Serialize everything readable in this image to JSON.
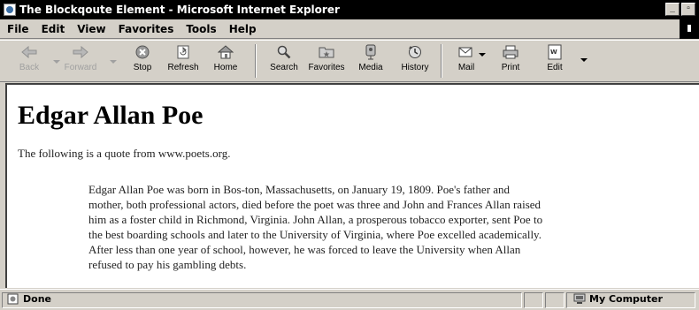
{
  "window": {
    "title": "The Blockqoute Element - Microsoft Internet Explorer"
  },
  "menu": [
    "File",
    "Edit",
    "View",
    "Favorites",
    "Tools",
    "Help"
  ],
  "toolbar": {
    "buttons": [
      {
        "label": "Back",
        "icon": "back-arrow-icon",
        "enabled": false
      },
      {
        "label": "Forward",
        "icon": "forward-arrow-icon",
        "enabled": false
      },
      {
        "label": "Stop",
        "icon": "stop-icon",
        "enabled": true
      },
      {
        "label": "Refresh",
        "icon": "refresh-icon",
        "enabled": true
      },
      {
        "label": "Home",
        "icon": "home-icon",
        "enabled": true
      },
      {
        "label": "Search",
        "icon": "search-icon",
        "enabled": true
      },
      {
        "label": "Favorites",
        "icon": "favorites-icon",
        "enabled": true
      },
      {
        "label": "Media",
        "icon": "media-icon",
        "enabled": true
      },
      {
        "label": "History",
        "icon": "history-icon",
        "enabled": true
      },
      {
        "label": "Mail",
        "icon": "mail-icon",
        "enabled": true
      },
      {
        "label": "Print",
        "icon": "print-icon",
        "enabled": true
      },
      {
        "label": "Edit",
        "icon": "edit-icon",
        "enabled": true
      }
    ]
  },
  "page": {
    "heading": "Edgar Allan Poe",
    "intro": "The following is a quote from www.poets.org.",
    "quote_lines": [
      "Edgar Allan Poe was born in Bos-ton, Massachusetts, on January 19, 1809. Poe's father and",
      "mother, both professional actors, died before the poet was three and John and Frances Allan raised",
      "him as a foster child in Richmond, Virginia. John Allan, a prosperous tobacco exporter, sent Poe to",
      "the best boarding schools and later to the University of Virginia, where Poe excelled academically.",
      "After less than one year of school, however, he was forced to leave the University when Allan",
      "refused to pay his gambling debts."
    ]
  },
  "status": {
    "left": "Done",
    "zone": "My Computer"
  },
  "colors": {
    "title_bar": "#000000",
    "chrome": "#d4d0c8",
    "page_background": "#ffffff"
  }
}
